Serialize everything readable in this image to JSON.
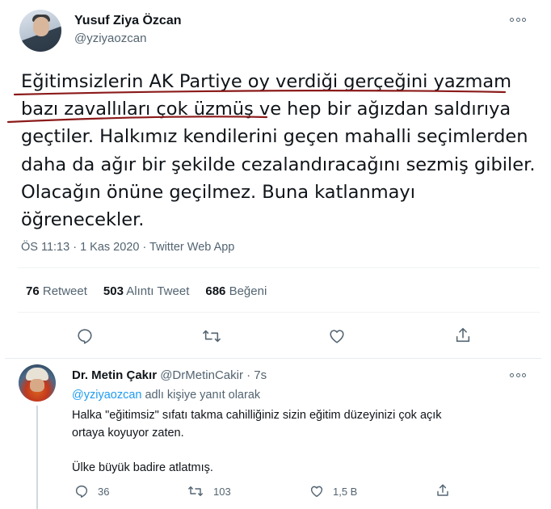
{
  "main_tweet": {
    "display_name": "Yusuf Ziya Özcan",
    "handle": "@yziyaozcan",
    "lines": [
      "Eğitimsizlerin AK Partiye oy verdiği gerçeğini yazmam",
      "bazı zavallıları çok üzmüş ve hep bir ağızdan saldırıya",
      "geçtiler. Halkımız kendilerini geçen mahalli seçimlerden",
      "daha da ağır bir şekilde cezalandıracağını sezmiş gibiler.",
      "Olacağın önüne geçilmez. Buna katlanmayı",
      "öğrenecekler."
    ],
    "meta": "ÖS 11:13 · 1 Kas 2020 · Twitter Web App",
    "stats": {
      "retweets_count": "76",
      "retweets_label": "Retweet",
      "quotes_count": "503",
      "quotes_label": "Alıntı Tweet",
      "likes_count": "686",
      "likes_label": "Beğeni"
    },
    "underline_color": "#8b1a1a"
  },
  "reply": {
    "display_name": "Dr. Metin Çakır",
    "handle": "@DrMetinCakir",
    "time": "· 7s",
    "replying_to_handle": "@yziyaozcan",
    "replying_to_suffix": "adlı kişiye yanıt olarak",
    "text_lines": [
      "Halka \"eğitimsiz\" sıfatı takma cahilliğiniz sizin eğitim düzeyinizi çok açık",
      "ortaya koyuyor zaten.",
      "Ülke büyük badire atlatmış."
    ],
    "reply_count": "36",
    "retweet_count": "103",
    "like_count": "1,5 B"
  },
  "icons": {
    "more": "more-horizontal-icon",
    "reply": "reply-icon",
    "retweet": "retweet-icon",
    "like": "heart-icon",
    "share": "share-icon"
  },
  "colors": {
    "accent": "#1d9bf0",
    "secondary_text": "#536471",
    "divider": "#eff3f4"
  }
}
